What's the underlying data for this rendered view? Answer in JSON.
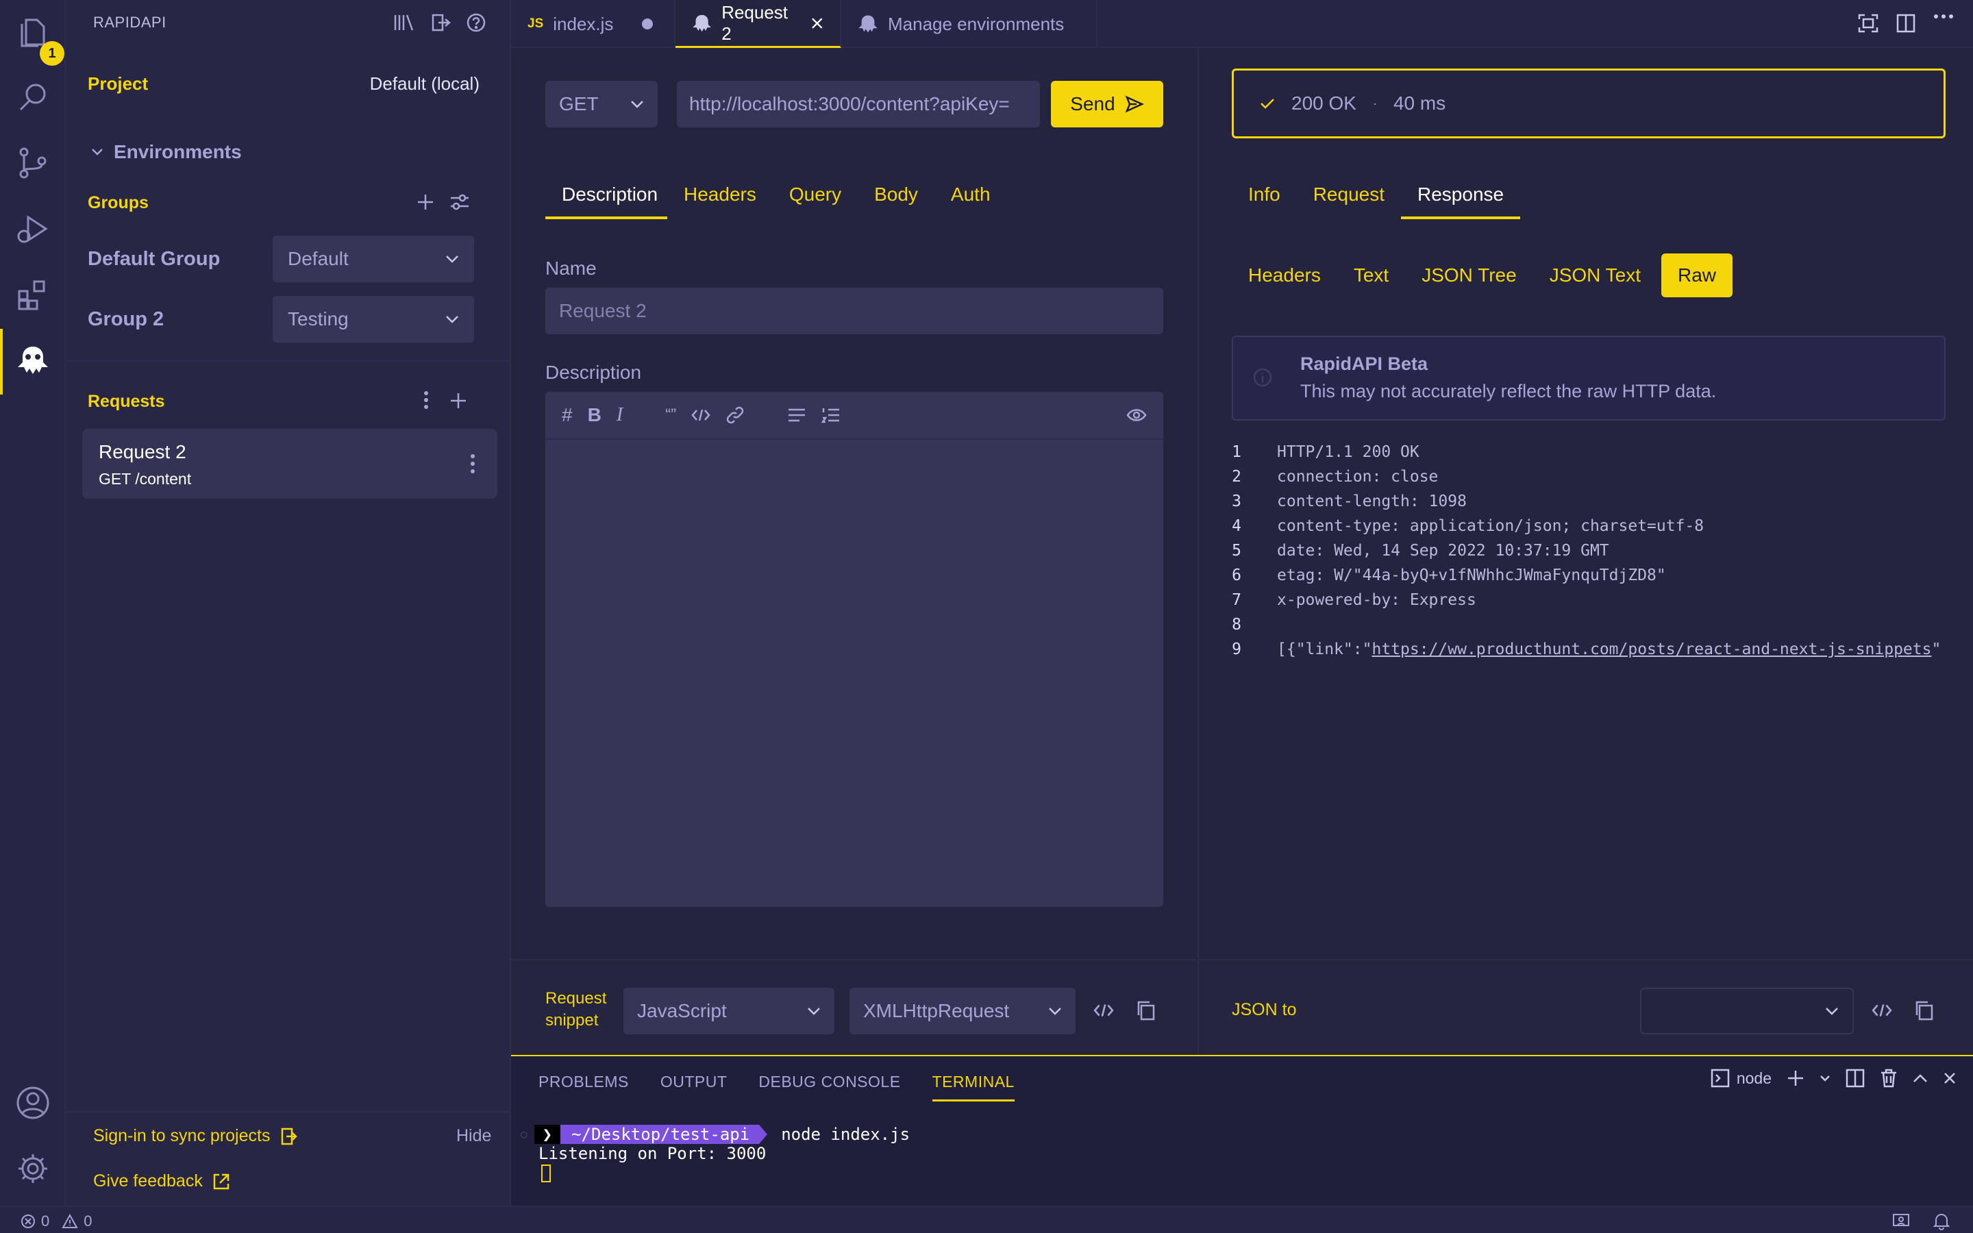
{
  "activity": {
    "badge": "1"
  },
  "sidebar": {
    "title": "RAPIDAPI",
    "project_label": "Project",
    "project_value": "Default (local)",
    "environments_label": "Environments",
    "groups_label": "Groups",
    "groups": [
      {
        "name": "Default Group",
        "value": "Default"
      },
      {
        "name": "Group 2",
        "value": "Testing"
      }
    ],
    "requests_label": "Requests",
    "request_item": {
      "name": "Request 2",
      "sub": "GET /content"
    },
    "signin": "Sign-in to sync projects",
    "hide": "Hide",
    "feedback": "Give feedback"
  },
  "tabs": [
    {
      "icon": "JS",
      "label": "index.js"
    },
    {
      "label": "Request 2"
    },
    {
      "label": "Manage environments"
    }
  ],
  "request": {
    "method": "GET",
    "url": "http://localhost:3000/content?apiKey=",
    "send": "Send",
    "tabs": [
      "Description",
      "Headers",
      "Query",
      "Body",
      "Auth"
    ],
    "name_label": "Name",
    "name_placeholder": "Request 2",
    "desc_label": "Description",
    "snippet_label_1": "Request",
    "snippet_label_2": "snippet",
    "snippet_lang": "JavaScript",
    "snippet_lib": "XMLHttpRequest"
  },
  "response": {
    "status": "200 OK",
    "time": "40 ms",
    "tabs": [
      "Info",
      "Request",
      "Response"
    ],
    "subtabs": [
      "Headers",
      "Text",
      "JSON Tree",
      "JSON Text",
      "Raw"
    ],
    "beta_title": "RapidAPI Beta",
    "beta_text": "This may not accurately reflect the raw HTTP data.",
    "lines": [
      "HTTP/1.1 200 OK",
      "connection: close",
      "content-length: 1098",
      "content-type: application/json; charset=utf-8",
      "date: Wed, 14 Sep 2022 10:37:19 GMT",
      "etag: W/\"44a-byQ+v1fNWhhcJWmaFynquTdjZD8\"",
      "x-powered-by: Express",
      ""
    ],
    "line9_prefix": "[{\"link\":\"",
    "line9_link": "https://ww.producthunt.com/posts/react-and-next-js-snippets",
    "line9_suffix": "\"",
    "json_to_label": "JSON to"
  },
  "terminal": {
    "tabs": [
      "PROBLEMS",
      "OUTPUT",
      "DEBUG CONSOLE",
      "TERMINAL"
    ],
    "shell": "node",
    "prompt_path": "~/Desktop/test-api",
    "command": "node index.js",
    "output": "Listening on Port: 3000"
  },
  "status": {
    "errors": "0",
    "warnings": "0"
  },
  "colors": {
    "accent": "#f5d60a",
    "background": "#25243f",
    "terminal_bg": "#1f1e3b",
    "prompt": "#7b4fe0"
  }
}
